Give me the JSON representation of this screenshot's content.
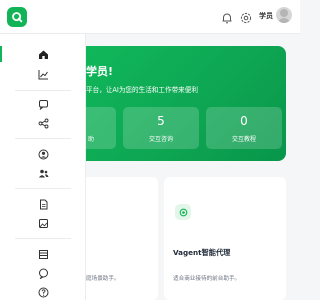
{
  "header": {
    "user_name": "学员",
    "icons": [
      "logo-icon",
      "bell-icon",
      "gear-icon",
      "avatar"
    ]
  },
  "sidebar": {
    "items": [
      {
        "icon": "home-icon",
        "active": true
      },
      {
        "icon": "chart-line-icon",
        "active": false
      },
      {
        "icon": "chat-bubble-icon",
        "active": false
      },
      {
        "icon": "share-icon",
        "active": false
      },
      {
        "icon": "user-circle-icon",
        "active": false
      },
      {
        "icon": "users-icon",
        "active": false
      },
      {
        "icon": "document-icon",
        "active": false
      },
      {
        "icon": "image-icon",
        "active": false
      },
      {
        "icon": "table-icon",
        "active": false
      },
      {
        "icon": "message-icon",
        "active": false
      },
      {
        "icon": "help-icon",
        "active": false
      }
    ]
  },
  "hero": {
    "title": "学员!",
    "subtitle": "平台，让AI为您的生活和工作带来便利",
    "stats": [
      {
        "value": "",
        "label": "助"
      },
      {
        "value": "5",
        "label": "交互咨询"
      },
      {
        "value": "0",
        "label": "交互教程"
      }
    ]
  },
  "cards": [
    {
      "title": "",
      "desc": "庭场景助手。"
    },
    {
      "title": "Vagent智能代理",
      "desc": "适合商业接待的前台助手。"
    }
  ],
  "colors": {
    "accent": "#12b457",
    "hero_dark": "#08964a",
    "page_bg": "#f5f6f7"
  }
}
